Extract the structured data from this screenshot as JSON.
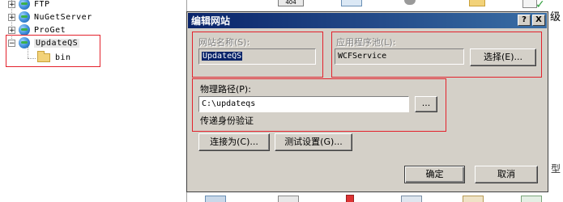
{
  "tree": {
    "items": [
      {
        "label": "FTP"
      },
      {
        "label": "NuGetServer"
      },
      {
        "label": "ProGet"
      },
      {
        "label": "UpdateQS"
      },
      {
        "label": "bin"
      }
    ]
  },
  "background": {
    "badge_404": "404",
    "edge_char": "级"
  },
  "dialog": {
    "title": "编辑网站",
    "help_btn": "?",
    "close_btn": "X",
    "site_name_label": "网站名称(S):",
    "site_name_value": "UpdateQS",
    "app_pool_label": "应用程序池(L):",
    "app_pool_value": "WCFService",
    "select_button": "选择(E)...",
    "physical_path_label": "物理路径(P):",
    "physical_path_value": "C:\\updateqs",
    "browse_button": "...",
    "pass_through_auth": "传递身份验证",
    "connect_as_button": "连接为(C)...",
    "test_settings_button": "测试设置(G)...",
    "ok_button": "确定",
    "cancel_button": "取消"
  },
  "colors": {
    "highlight": "#e3222c",
    "title_start": "#0a246a",
    "title_end": "#3a6ea5",
    "dialog_face": "#d4d0c8"
  }
}
